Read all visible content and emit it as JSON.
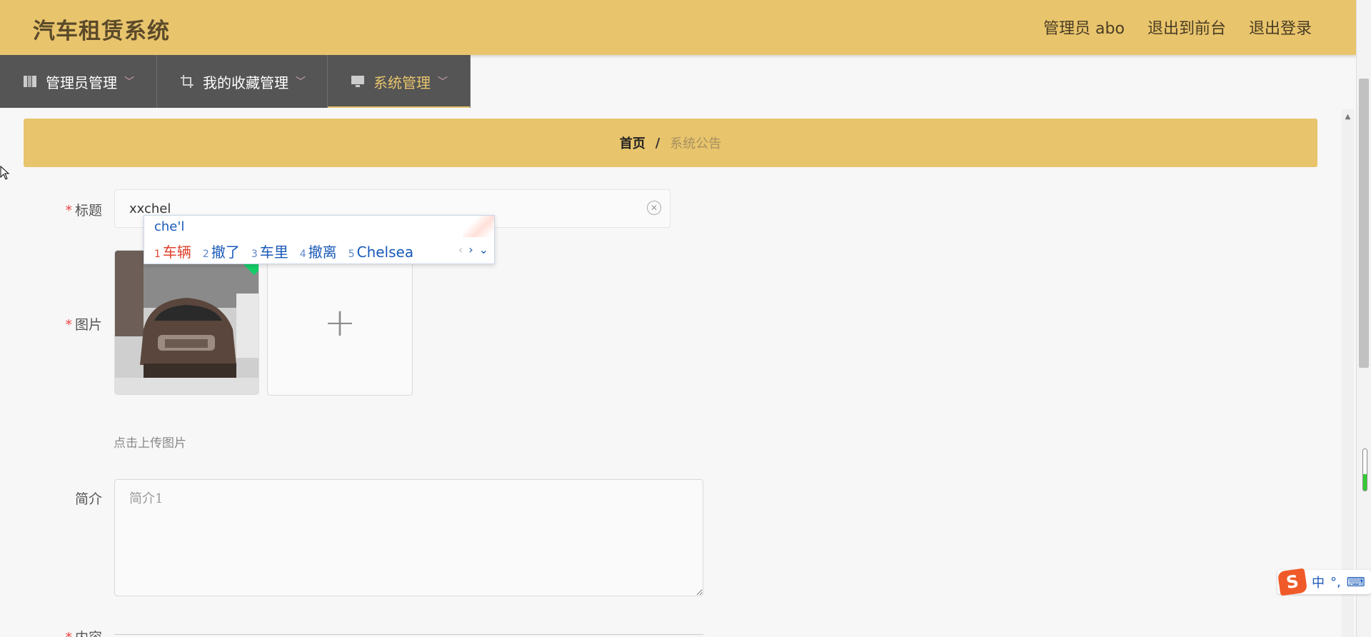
{
  "header": {
    "brand": "汽车租赁系统",
    "admin_label": "管理员 abo",
    "front_link": "退出到前台",
    "logout_link": "退出登录"
  },
  "nav": {
    "items": [
      {
        "label": "管理员管理",
        "icon": "building-icon",
        "active": false
      },
      {
        "label": "我的收藏管理",
        "icon": "crop-icon",
        "active": false
      },
      {
        "label": "系统管理",
        "icon": "monitor-icon",
        "active": true
      }
    ]
  },
  "breadcrumb": {
    "home": "首页",
    "separator": "/",
    "current": "系统公告"
  },
  "form": {
    "title_label": "标题",
    "title_value": "xxchel",
    "image_label": "图片",
    "upload_hint": "点击上传图片",
    "intro_label": "简介",
    "intro_placeholder": "简介1",
    "content_label": "内容"
  },
  "ime": {
    "composition": "che'l",
    "candidates": [
      {
        "num": "1",
        "text": "车辆"
      },
      {
        "num": "2",
        "text": "撤了"
      },
      {
        "num": "3",
        "text": "车里"
      },
      {
        "num": "4",
        "text": "撤离"
      },
      {
        "num": "5",
        "text": "Chelsea"
      }
    ],
    "prev": "‹",
    "next": "›",
    "expand": "⌄"
  },
  "ime_toolbar": {
    "logo": "S",
    "mode": "中",
    "punct": "°,",
    "keyboard": "⌨"
  },
  "colors": {
    "header_bg": "#e8c46c",
    "nav_bg": "#555555",
    "active_nav": "#e8c46c",
    "required": "#e44444"
  }
}
